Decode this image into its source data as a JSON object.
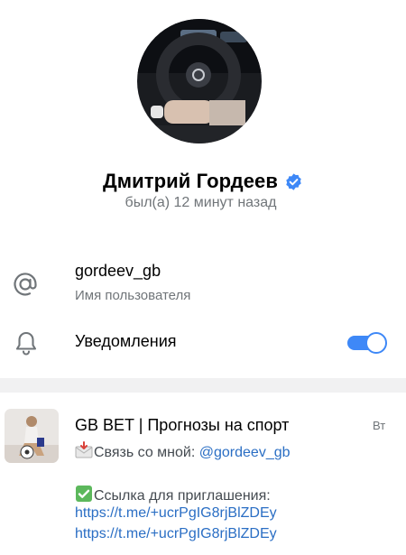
{
  "profile": {
    "name": "Дмитрий Гордеев",
    "last_seen": "был(а) 12 минут назад",
    "verified": true
  },
  "info": {
    "username": "gordeev_gb",
    "username_label": "Имя пользователя",
    "notifications_label": "Уведомления",
    "notifications_on": true
  },
  "chat": {
    "title": "GB BET | Прогнозы на спорт",
    "time": "Вт",
    "contact_text": "Связь со мной: ",
    "contact_link": "@gordeev_gb",
    "invite_text": "Ссылка для приглашения:",
    "invite_link_1": "https://t.me/+ucrPgIG8rjBlZDEy",
    "invite_link_2": "https://t.me/+ucrPgIG8rjBlZDEy"
  },
  "colors": {
    "accent": "#3e88f7",
    "secondary_text": "#707579",
    "link": "#2a6ec4",
    "divider": "#f1f1f2"
  },
  "icons": [
    "verified-badge-icon",
    "at-sign-icon",
    "bell-icon",
    "envelope-emoji-icon",
    "check-mark-emoji-icon"
  ]
}
